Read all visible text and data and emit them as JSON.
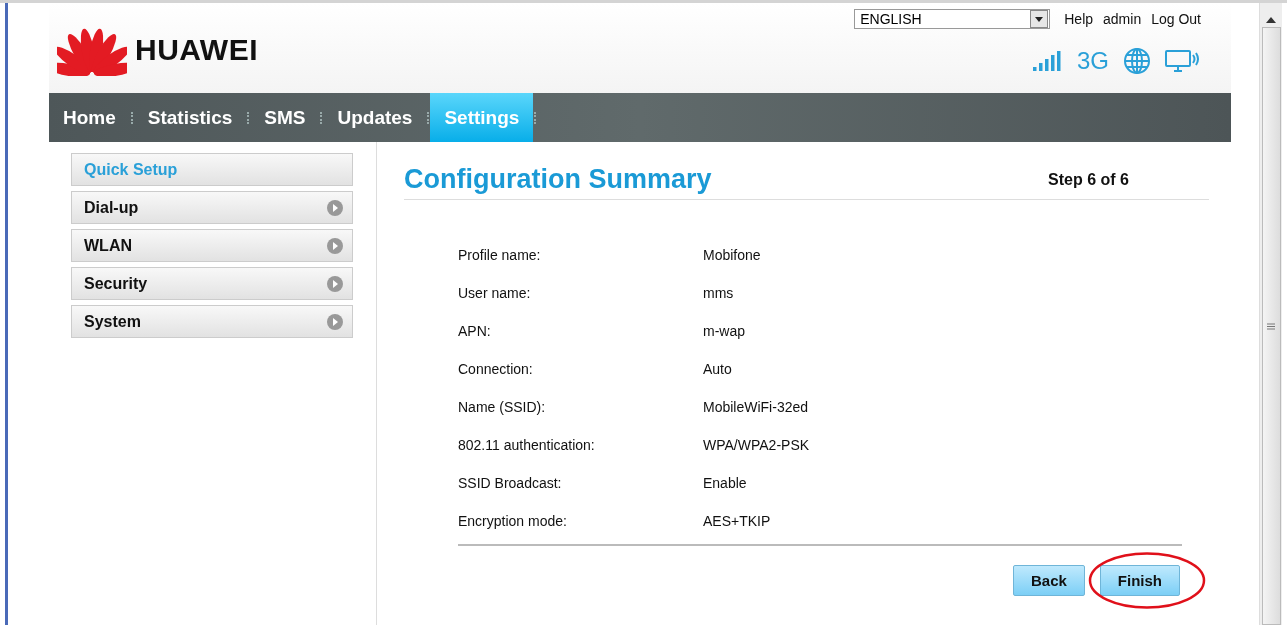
{
  "top_bar": {
    "language": "ENGLISH",
    "links": [
      "Help",
      "admin",
      "Log Out"
    ]
  },
  "brand": "HUAWEI",
  "status": {
    "network": "3G"
  },
  "nav": [
    {
      "label": "Home",
      "selected": false
    },
    {
      "label": "Statistics",
      "selected": false
    },
    {
      "label": "SMS",
      "selected": false
    },
    {
      "label": "Updates",
      "selected": false
    },
    {
      "label": "Settings",
      "selected": true
    }
  ],
  "sidebar": {
    "items": [
      {
        "label": "Quick Setup",
        "kind": "link",
        "selected": true
      },
      {
        "label": "Dial-up",
        "kind": "menu",
        "selected": false
      },
      {
        "label": "WLAN",
        "kind": "menu",
        "selected": false
      },
      {
        "label": "Security",
        "kind": "menu",
        "selected": false
      },
      {
        "label": "System",
        "kind": "menu",
        "selected": false
      }
    ]
  },
  "main": {
    "title": "Configuration Summary",
    "step": "Step 6 of 6",
    "rows": [
      {
        "label": "Profile name:",
        "value": "Mobifone"
      },
      {
        "label": "User name:",
        "value": "mms"
      },
      {
        "label": "APN:",
        "value": "m-wap"
      },
      {
        "label": "Connection:",
        "value": "Auto"
      },
      {
        "label": "Name (SSID):",
        "value": "MobileWiFi-32ed"
      },
      {
        "label": "802.11 authentication:",
        "value": "WPA/WPA2-PSK"
      },
      {
        "label": "SSID Broadcast:",
        "value": "Enable"
      },
      {
        "label": "Encryption mode:",
        "value": "AES+TKIP"
      }
    ],
    "buttons": [
      {
        "label": "Back",
        "highlighted": false
      },
      {
        "label": "Finish",
        "highlighted": true
      }
    ]
  }
}
